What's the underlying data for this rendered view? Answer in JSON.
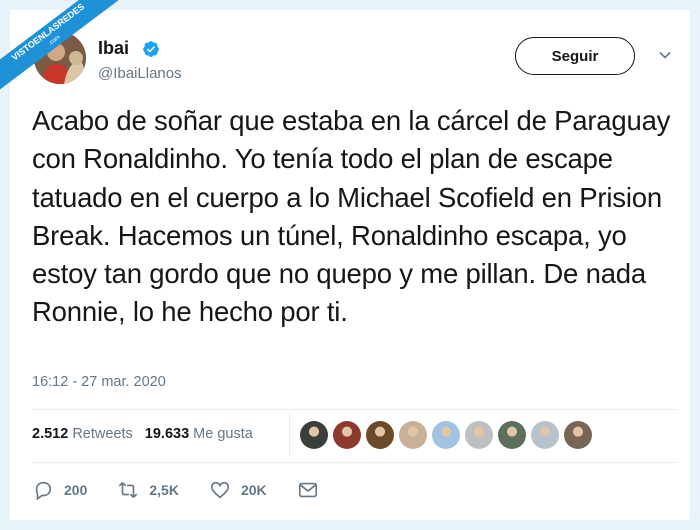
{
  "watermark": {
    "text": "VISTOENLASREDES",
    "sub": ".com"
  },
  "author": {
    "name": "Ibai",
    "handle": "@IbaiLlanos"
  },
  "follow_label": "Seguir",
  "tweet_text": "Acabo de soñar que estaba en la cárcel de Paraguay con Ronaldinho. Yo tenía todo el plan de escape tatuado en el cuerpo a lo Michael Scofield en Prision Break. Hacemos un túnel, Ronaldinho escapa, yo estoy tan gordo que no quepo y me pillan. De nada Ronnie, lo he hecho por ti.",
  "timestamp": "16:12 - 27 mar. 2020",
  "stats": {
    "retweets_count": "2.512",
    "retweets_label": "Retweets",
    "likes_count": "19.633",
    "likes_label": "Me gusta"
  },
  "likers": [
    "#3b3f3a",
    "#8c3a2e",
    "#6b4a2b",
    "#c9b199",
    "#9fc3e0",
    "#bfbfbf",
    "#5b6f5a",
    "#b8c2cc",
    "#776655"
  ],
  "actions": {
    "replies": "200",
    "retweets": "2,5K",
    "likes": "20K"
  },
  "colors": {
    "accent": "#1da1f2",
    "text": "#14171a",
    "muted": "#657786",
    "watermark": "#1f91d6"
  }
}
